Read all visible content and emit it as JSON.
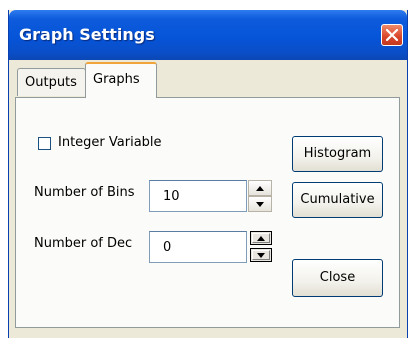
{
  "window": {
    "title": "Graph Settings"
  },
  "tabs": [
    {
      "label": "Outputs",
      "active": false
    },
    {
      "label": "Graphs",
      "active": true
    }
  ],
  "graphs_panel": {
    "integer_variable": {
      "label": "Integer Variable",
      "checked": false
    },
    "number_of_bins": {
      "label": "Number of Bins",
      "value": "10"
    },
    "number_of_dec": {
      "label": "Number of Dec",
      "value": "0"
    },
    "buttons": {
      "histogram": "Histogram",
      "cumulative": "Cumulative",
      "close": "Close"
    }
  },
  "icons": {
    "close": "close-icon",
    "spin_up": "up-arrow-icon",
    "spin_down": "down-arrow-icon"
  },
  "colors": {
    "titlebar": "#0654d8",
    "dialog_bg": "#ece9d8",
    "close_button": "#d9452a",
    "active_tab_highlight": "#f1a43a"
  }
}
